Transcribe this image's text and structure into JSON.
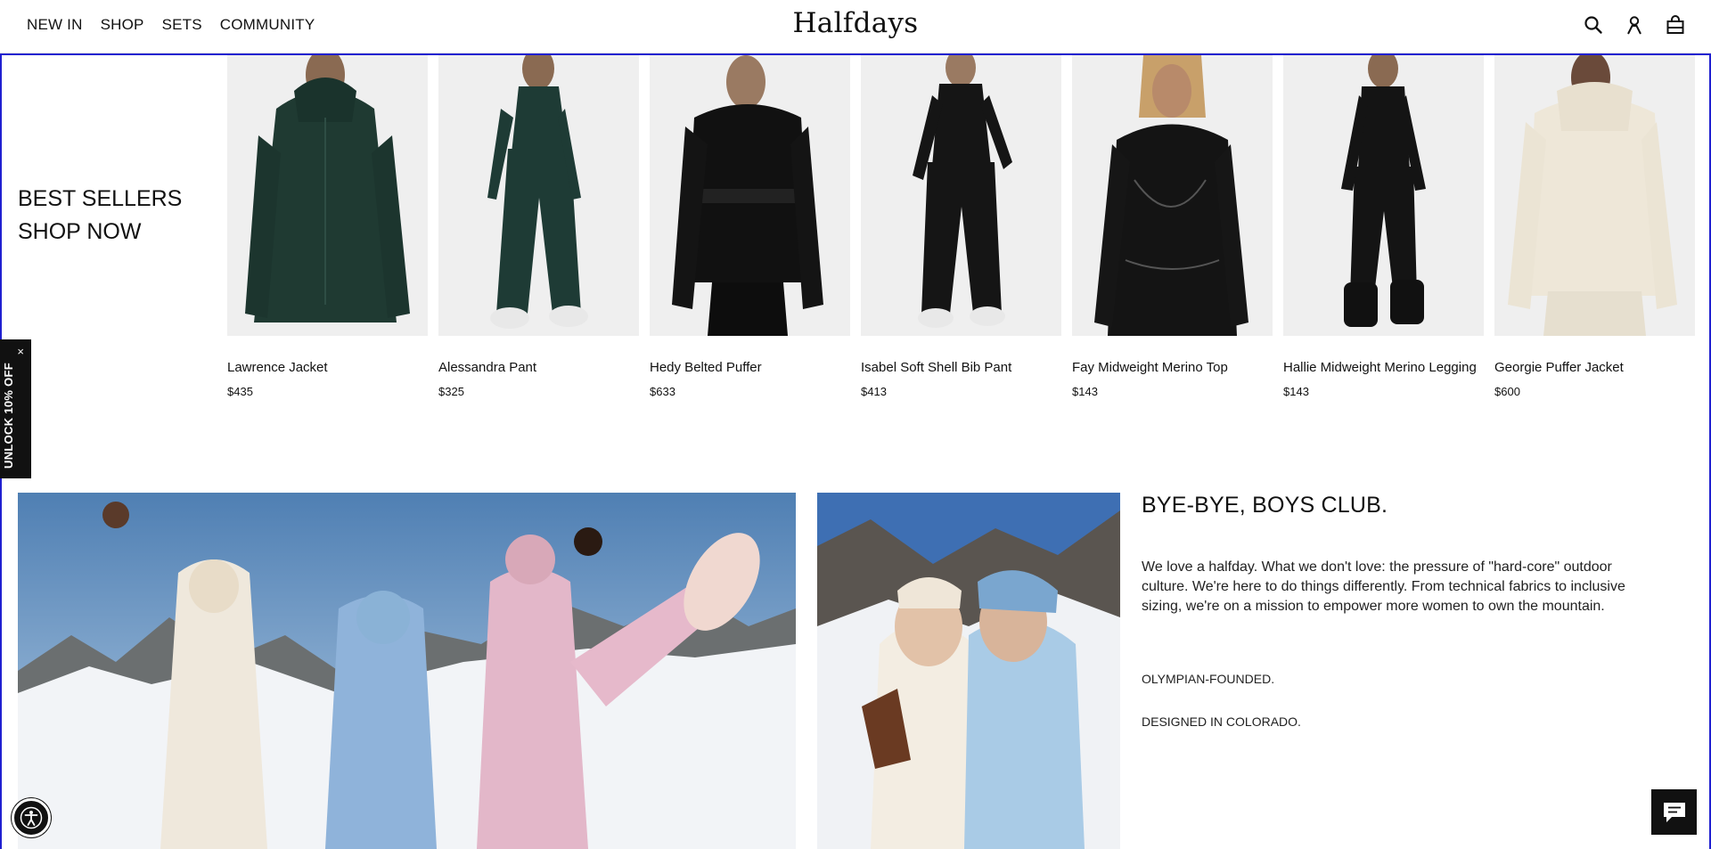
{
  "header": {
    "nav": [
      "NEW IN",
      "SHOP",
      "SETS",
      "COMMUNITY"
    ],
    "logo": "Halfdays",
    "icons": [
      "search-icon",
      "account-icon",
      "bag-icon"
    ]
  },
  "best_sellers": {
    "line1": "BEST SELLERS",
    "line2": "SHOP NOW"
  },
  "products": [
    {
      "name": "Lawrence Jacket",
      "price": "$435",
      "color": "#1f3a32"
    },
    {
      "name": "Alessandra Pant",
      "price": "$325",
      "color": "#1e3b35"
    },
    {
      "name": "Hedy Belted Puffer",
      "price": "$633",
      "color": "#111111"
    },
    {
      "name": "Isabel Soft Shell Bib Pant",
      "price": "$413",
      "color": "#151515"
    },
    {
      "name": "Fay Midweight Merino Top",
      "price": "$143",
      "color": "#141414"
    },
    {
      "name": "Hallie Midweight Merino Legging",
      "price": "$143",
      "color": "#141414"
    },
    {
      "name": "Georgie Puffer Jacket",
      "price": "$600",
      "color": "#eee7d8"
    }
  ],
  "promo_tab": {
    "label": "UNLOCK 10% OFF",
    "close": "×"
  },
  "story": {
    "heading": "BYE-BYE, BOYS CLUB.",
    "paragraph": "We love a halfday. What we don't love: the pressure of \"hard-core\" outdoor culture. We're here to do things differently. From technical fabrics to inclusive sizing, we're on a mission to empower more women to own the mountain.",
    "tag1": "OLYMPIAN-FOUNDED.",
    "tag2": "DESIGNED IN COLORADO."
  },
  "widgets": {
    "chat_icon": "chat-icon",
    "accessibility_icon": "accessibility-icon"
  }
}
